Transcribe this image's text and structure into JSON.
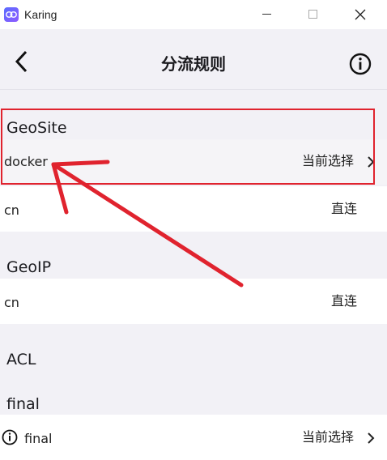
{
  "window": {
    "title": "Karing"
  },
  "header": {
    "title": "分流规则"
  },
  "sections": [
    {
      "title": "GeoSite",
      "rows": [
        {
          "label": "docker",
          "value": "当前选择"
        },
        {
          "label": "cn",
          "value": "直连"
        }
      ]
    },
    {
      "title": "GeoIP",
      "rows": [
        {
          "label": "cn",
          "value": "直连"
        }
      ]
    },
    {
      "title": "ACL",
      "rows": []
    },
    {
      "title": "final",
      "rows": [
        {
          "label": "final",
          "value": "当前选择"
        }
      ]
    }
  ],
  "colors": {
    "background": "#f2f1f6",
    "row": "#ffffff",
    "annotation": "#e0232e"
  }
}
